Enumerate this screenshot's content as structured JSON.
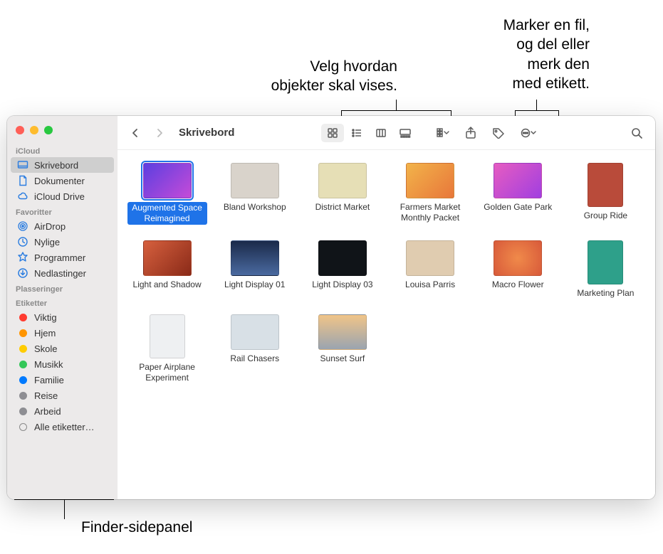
{
  "annotations": {
    "view_options": "Velg hvordan\nobjekter skal vises.",
    "share_tag": "Marker en fil,\nog del eller\nmerk den\nmed etikett.",
    "sidebar_label": "Finder-sidepanel"
  },
  "toolbar": {
    "title": "Skrivebord"
  },
  "sidebar": {
    "sections": [
      {
        "header": "iCloud",
        "items": [
          {
            "label": "Skrivebord",
            "icon": "desktop",
            "selected": true
          },
          {
            "label": "Dokumenter",
            "icon": "doc"
          },
          {
            "label": "iCloud Drive",
            "icon": "cloud"
          }
        ]
      },
      {
        "header": "Favoritter",
        "items": [
          {
            "label": "AirDrop",
            "icon": "airdrop"
          },
          {
            "label": "Nylige",
            "icon": "clock"
          },
          {
            "label": "Programmer",
            "icon": "app"
          },
          {
            "label": "Nedlastinger",
            "icon": "download"
          }
        ]
      },
      {
        "header": "Plasseringer",
        "items": []
      },
      {
        "header": "Etiketter",
        "items": [
          {
            "label": "Viktig",
            "icon": "tag",
            "color": "#ff3b30"
          },
          {
            "label": "Hjem",
            "icon": "tag",
            "color": "#ff9500"
          },
          {
            "label": "Skole",
            "icon": "tag",
            "color": "#ffcc00"
          },
          {
            "label": "Musikk",
            "icon": "tag",
            "color": "#34c759"
          },
          {
            "label": "Familie",
            "icon": "tag",
            "color": "#007aff"
          },
          {
            "label": "Reise",
            "icon": "tag",
            "color": "#8e8e93"
          },
          {
            "label": "Arbeid",
            "icon": "tag",
            "color": "#8e8e93"
          },
          {
            "label": "Alle etiketter…",
            "icon": "alltags"
          }
        ]
      }
    ]
  },
  "files": [
    {
      "name": "Augmented Space Reimagined",
      "selected": true,
      "bg": "linear-gradient(135deg,#5c3fe0,#c54bd8)"
    },
    {
      "name": "Bland Workshop",
      "bg": "#d9d3cb"
    },
    {
      "name": "District Market",
      "bg": "#e6dfb6"
    },
    {
      "name": "Farmers Market Monthly Packet",
      "bg": "linear-gradient(135deg,#f2b34a,#e8773a)"
    },
    {
      "name": "Golden Gate Park",
      "bg": "linear-gradient(135deg,#e65cc1,#a13fe0)"
    },
    {
      "name": "Group Ride",
      "bg": "#b94b3a",
      "doc": true
    },
    {
      "name": "Light and Shadow",
      "bg": "linear-gradient(135deg,#d6603e,#8a2a18)"
    },
    {
      "name": "Light Display 01",
      "bg": "linear-gradient(180deg,#1a2a4a,#4a6aa0)"
    },
    {
      "name": "Light Display 03",
      "bg": "#101418"
    },
    {
      "name": "Louisa Parris",
      "bg": "#e0ccb0"
    },
    {
      "name": "Macro Flower",
      "bg": "radial-gradient(circle,#f08a4a,#d85a3a)"
    },
    {
      "name": "Marketing Plan",
      "bg": "#2ea08a",
      "doc": true
    },
    {
      "name": "Paper Airplane Experiment",
      "bg": "#eef0f2",
      "doc": true
    },
    {
      "name": "Rail Chasers",
      "bg": "#d8e0e6"
    },
    {
      "name": "Sunset Surf",
      "bg": "linear-gradient(180deg,#f0c488,#9aa4b0)"
    }
  ]
}
